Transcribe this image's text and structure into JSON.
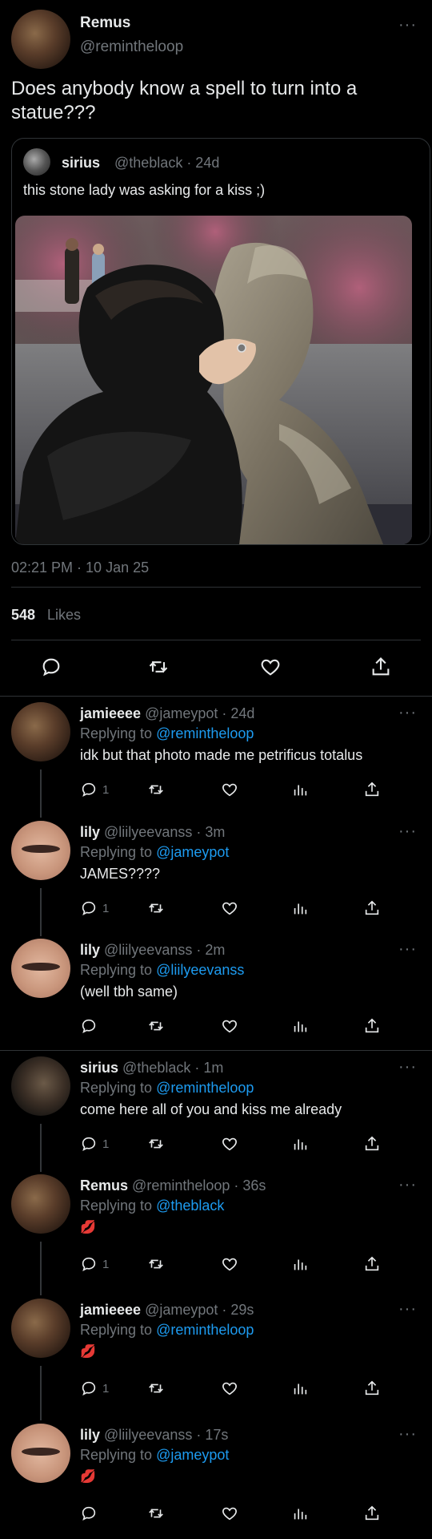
{
  "tweet": {
    "display_name": "Remus",
    "handle": "@remintheloop",
    "text": "Does anybody know a spell to turn into a statue???",
    "time": "02:21 PM · 10 Jan 25",
    "likes_count": "548",
    "likes_label": "Likes",
    "more": "···"
  },
  "quote": {
    "display_name": "sirius",
    "handle": "@theblack · 24d",
    "text": "this stone lady was asking for a kiss ;)"
  },
  "replies": [
    {
      "name": "jamieeee",
      "handle": "@jameypot",
      "time": "24d",
      "replying_prefix": "Replying to ",
      "replying_to": "@remintheloop",
      "text": "idk but that photo made me petrificus totalus",
      "reply_count": "1"
    },
    {
      "name": "lily",
      "handle": "@liilyeevanss",
      "time": "3m",
      "replying_prefix": "Replying to ",
      "replying_to": "@jameypot",
      "text": "JAMES????",
      "reply_count": "1"
    },
    {
      "name": "lily",
      "handle": "@liilyeevanss",
      "time": "2m",
      "replying_prefix": "Replying to ",
      "replying_to": "@liilyeevanss",
      "text": "(well tbh same)",
      "reply_count": ""
    },
    {
      "name": "sirius",
      "handle": "@theblack",
      "time": "1m",
      "replying_prefix": "Replying to ",
      "replying_to": "@remintheloop",
      "text": "come here all of you and kiss me already",
      "reply_count": "1"
    },
    {
      "name": "Remus",
      "handle": "@remintheloop",
      "time": "36s",
      "replying_prefix": "Replying to ",
      "replying_to": "@theblack",
      "text": "💋",
      "reply_count": "1"
    },
    {
      "name": "jamieeee",
      "handle": "@jameypot",
      "time": "29s",
      "replying_prefix": "Replying to ",
      "replying_to": "@remintheloop",
      "text": "💋",
      "reply_count": "1"
    },
    {
      "name": "lily",
      "handle": "@liilyeevanss",
      "time": "17s",
      "replying_prefix": "Replying to ",
      "replying_to": "@jameypot",
      "text": "💋",
      "reply_count": ""
    }
  ],
  "colors": {
    "background": "#000000",
    "text": "#e7e9ea",
    "muted": "#71767b",
    "link": "#1d9bf0",
    "divider": "#2f3336",
    "kiss": "#e0245e"
  },
  "icons": [
    "reply-icon",
    "retweet-icon",
    "like-icon",
    "views-icon",
    "share-icon",
    "more-icon"
  ]
}
